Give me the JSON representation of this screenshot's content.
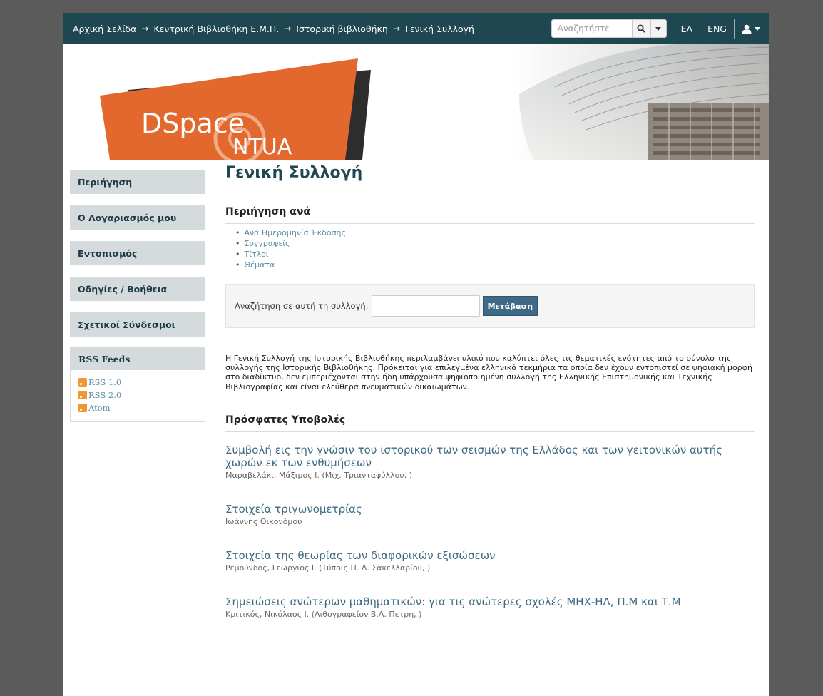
{
  "breadcrumb": [
    "Αρχική Σελίδα",
    "Κεντρική Βιβλιοθήκη Ε.Μ.Π.",
    "Ιστορική βιβλιοθήκη",
    "Γενική Συλλογή"
  ],
  "breadcrumb_separator": "→",
  "search": {
    "placeholder": "Αναζητήστε"
  },
  "languages": [
    "ΕΛ",
    "ENG"
  ],
  "banner": {
    "logo_text": "DSpace",
    "logo_sub": "NTUA",
    "logo_color": "#e2682e",
    "logo_dark_color": "#2d2d2d"
  },
  "sidebar": {
    "items": [
      "Περιήγηση",
      "Ο Λογαριασμός μου",
      "Εντοπισμός",
      "Οδηγίες / Βοήθεια",
      "Σχετικοί Σύνδεσμοι"
    ],
    "rss": {
      "title": "RSS Feeds",
      "links": [
        "RSS 1.0",
        "RSS 2.0",
        "Atom"
      ]
    }
  },
  "main": {
    "title": "Γενική Συλλογή",
    "browse_title": "Περιήγηση ανά",
    "browse_links": [
      "Ανά Ημερομηνία Έκδοσης",
      "Συγγραφείς",
      "Τίτλοι",
      "Θέματα"
    ],
    "collection_search_label": "Αναζήτηση σε αυτή τη συλλογή:",
    "go_button": "Μετάβαση",
    "intro": "Η Γενική Συλλογή της Ιστορικής Βιβλιοθήκης περιλαμβάνει υλικό που καλύπτει όλες τις θεματικές ενότητες από το σύνολο της συλλογής της Ιστορικής Βιβλιοθήκης. Πρόκειται για επιλεγμένα ελληνικά τεκμήρια τα οποία δεν έχουν εντοπιστεί σε ψηφιακή μορφή στο διαδίκτυο, δεν εμπεριέχονται στην ήδη υπάρχουσα ψηφιοποιημένη συλλογή της Ελληνικής Επιστημονικής και Τεχνικής Βιβλιογραφίας και είναι ελεύθερα πνευματικών δικαιωμάτων.",
    "recent_title": "Πρόσφατες Υποβολές",
    "recent": [
      {
        "title": "Συμβολή εις την γνώσιν του ιστορικού των σεισμών της Ελλάδος και των γειτονικών αυτής χωρών εκ των ενθυμήσεων",
        "author": "Μαραβελάκι, Μάξιμος Ι. (Μιχ. Τριανταφύλλου, )"
      },
      {
        "title": "Στοιχεία τριγωνομετρίας",
        "author": "Ιωάννης Οικονόμου"
      },
      {
        "title": "Στοιχεία της θεωρίας των διαφορικών εξισώσεων",
        "author": "Ρεμούνδος, Γεώργιος Ι. (Τύποις Π. Δ. Σακελλαρίου, )"
      },
      {
        "title": "Σημειώσεις ανώτερων μαθηματικών: για τις ανώτερες σχολές ΜΗΧ-ΗΛ, Π.Μ και Τ.Μ",
        "author": "Κριτικός, Νικόλαος Ι. (Λιθογραφείον Β.Α. Πετρη, )"
      }
    ]
  },
  "colors": {
    "topbar": "#1f4752",
    "sidebar_item": "#d5dbdd",
    "link": "#5a8fa2",
    "button": "#3f6a86",
    "outer_bg": "#5b5b5b"
  }
}
